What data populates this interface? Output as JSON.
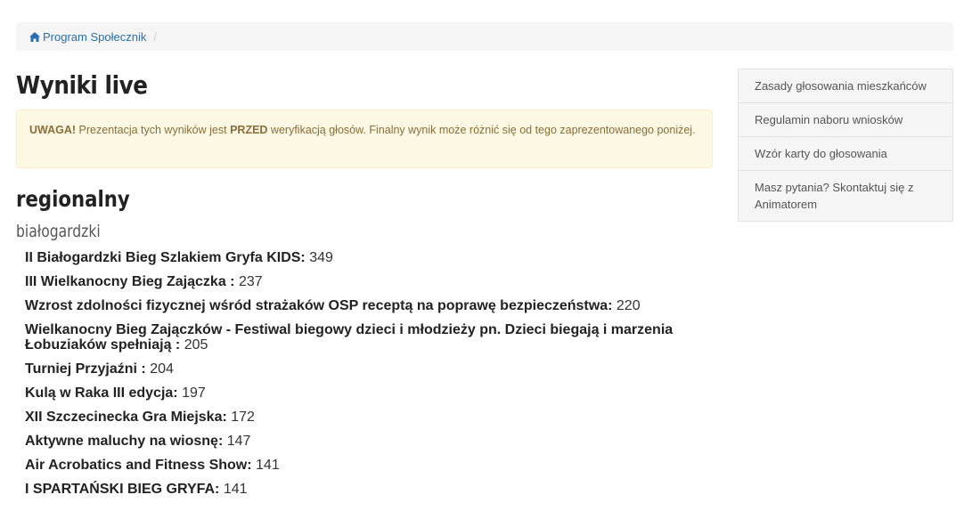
{
  "breadcrumb": {
    "home_label": "Program Społecznik",
    "separator": "/"
  },
  "page": {
    "title": "Wyniki live"
  },
  "alert": {
    "strong1": "UWAGA!",
    "text1": " Prezentacja tych wyników jest ",
    "strong2": "PRZED",
    "text2": " weryfikacją głosów. Finalny wynik może różnić się od tego zaprezentowanego poniżej."
  },
  "section": {
    "title": "regionalny",
    "subtitle": "białogardzki"
  },
  "results": [
    {
      "name": "II Białogardzki Bieg Szlakiem Gryfa KIDS:",
      "votes": "349"
    },
    {
      "name": "III Wielkanocny Bieg Zajączka :",
      "votes": "237"
    },
    {
      "name": "Wzrost zdolności fizycznej wśród strażaków OSP receptą na poprawę bezpieczeństwa:",
      "votes": "220"
    },
    {
      "name": "Wielkanocny Bieg Zajączków - Festiwal biegowy dzieci i młodzieży pn. Dzieci biegają i marzenia Łobuziaków spełniają :",
      "votes": "205"
    },
    {
      "name": "Turniej Przyjaźni :",
      "votes": "204"
    },
    {
      "name": "Kulą w Raka III edycja:",
      "votes": "197"
    },
    {
      "name": "XII Szczecinecka Gra Miejska:",
      "votes": "172"
    },
    {
      "name": "Aktywne maluchy na wiosnę:",
      "votes": "147"
    },
    {
      "name": "Air Acrobatics and Fitness Show:",
      "votes": "141"
    },
    {
      "name": "I SPARTAŃSKI BIEG GRYFA:",
      "votes": "141"
    }
  ],
  "sidebar": {
    "items": [
      {
        "label": "Zasady głosowania mieszkańców"
      },
      {
        "label": "Regulamin naboru wniosków"
      },
      {
        "label": "Wzór karty do głosowania"
      },
      {
        "label": "Masz pytania? Skontaktuj się z Animatorem"
      }
    ]
  },
  "colors": {
    "link": "#2a6fb0",
    "alert_bg": "#fcf8e3",
    "alert_border": "#faebcc",
    "alert_text": "#8a6d3b"
  }
}
